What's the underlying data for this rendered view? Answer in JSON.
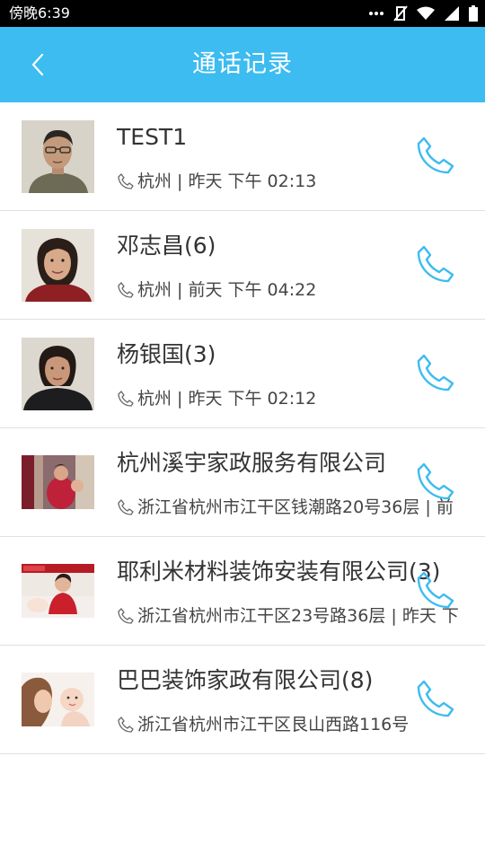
{
  "status_bar": {
    "time": "傍晚6:39",
    "icons": [
      "more-dots-icon",
      "signal-muted-icon",
      "wifi-icon",
      "cell-signal-icon",
      "battery-icon"
    ]
  },
  "header": {
    "title": "通话记录",
    "back_icon": "chevron-left-icon"
  },
  "colors": {
    "header_bg": "#3cbcf0",
    "dial_icon": "#3cbcf0"
  },
  "calls": [
    {
      "name": "TEST1",
      "detail": "杭州 | 昨天 下午  02:13",
      "avatar": "man-portrait"
    },
    {
      "name": "邓志昌(6)",
      "detail": "杭州 | 前天 下午  04:22",
      "avatar": "woman-portrait"
    },
    {
      "name": "杨银国(3)",
      "detail": "杭州 | 昨天 下午  02:12",
      "avatar": "woman-portrait-dark"
    },
    {
      "name": "杭州溪宇家政服务有限公司",
      "detail": "浙江省杭州市江干区钱潮路20号36层 | 前",
      "avatar": "housekeeping-photo"
    },
    {
      "name": "耶利米材料装饰安装有限公司(3)",
      "detail": "浙江省杭州市江干区23号路36层 | 昨天  下",
      "avatar": "nanny-photo"
    },
    {
      "name": "巴巴装饰家政有限公司(8)",
      "detail": "浙江省杭州市江干区艮山西路116号",
      "avatar": "mother-baby-photo"
    }
  ]
}
